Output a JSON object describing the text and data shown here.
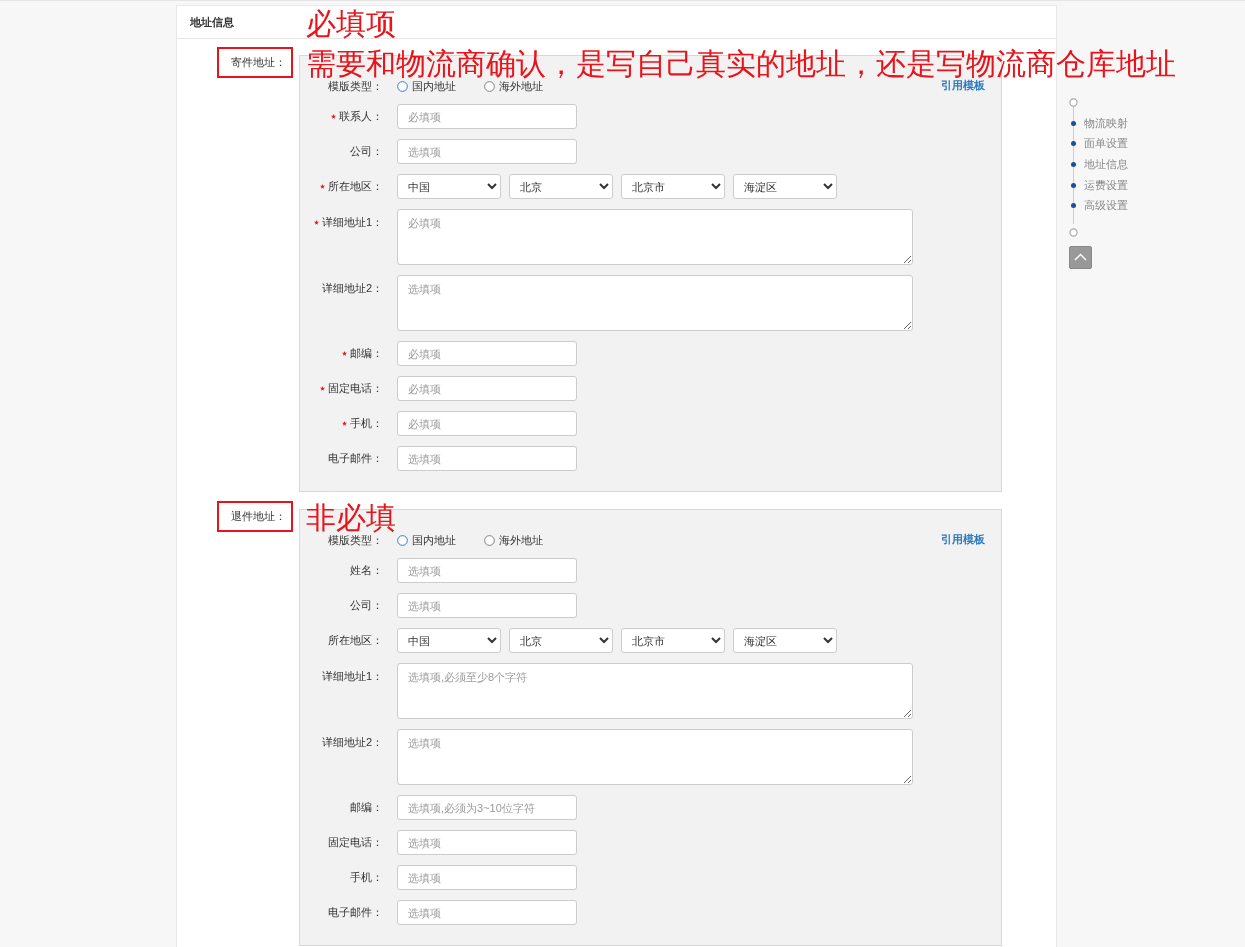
{
  "card": {
    "title": "地址信息"
  },
  "sections": [
    {
      "label": "寄件地址：",
      "highlighted": true,
      "annotations": [
        "必填项",
        "需要和物流商确认，是写自己真实的地址，还是写物流商仓库地址"
      ],
      "template_type": {
        "label": "模版类型：",
        "options": [
          {
            "label": "国内地址",
            "selected": true
          },
          {
            "label": "海外地址",
            "selected": false
          }
        ]
      },
      "template_link": "引用模板",
      "fields": [
        {
          "kind": "input",
          "label": "联系人：",
          "required": true,
          "placeholder": "必填项"
        },
        {
          "kind": "input",
          "label": "公司：",
          "required": false,
          "placeholder": "选填项"
        },
        {
          "kind": "selects",
          "label": "所在地区：",
          "required": true,
          "values": [
            "中国",
            "北京",
            "北京市",
            "海淀区"
          ]
        },
        {
          "kind": "textarea",
          "label": "详细地址1：",
          "required": true,
          "placeholder": "必填项"
        },
        {
          "kind": "textarea",
          "label": "详细地址2：",
          "required": false,
          "placeholder": "选填项"
        },
        {
          "kind": "input",
          "label": "邮编：",
          "required": true,
          "placeholder": "必填项"
        },
        {
          "kind": "input",
          "label": "固定电话：",
          "required": true,
          "placeholder": "必填项"
        },
        {
          "kind": "input",
          "label": "手机：",
          "required": true,
          "placeholder": "必填项"
        },
        {
          "kind": "input",
          "label": "电子邮件：",
          "required": false,
          "placeholder": "选填项"
        }
      ]
    },
    {
      "label": "退件地址：",
      "highlighted": true,
      "annotations": [
        "非必填"
      ],
      "template_type": {
        "label": "模版类型：",
        "options": [
          {
            "label": "国内地址",
            "selected": true
          },
          {
            "label": "海外地址",
            "selected": false
          }
        ]
      },
      "template_link": "引用模板",
      "fields": [
        {
          "kind": "input",
          "label": "姓名：",
          "required": false,
          "placeholder": "选填项"
        },
        {
          "kind": "input",
          "label": "公司：",
          "required": false,
          "placeholder": "选填项"
        },
        {
          "kind": "selects",
          "label": "所在地区：",
          "required": false,
          "values": [
            "中国",
            "北京",
            "北京市",
            "海淀区"
          ]
        },
        {
          "kind": "textarea",
          "label": "详细地址1：",
          "required": false,
          "placeholder": "选填项,必须至少8个字符"
        },
        {
          "kind": "textarea",
          "label": "详细地址2：",
          "required": false,
          "placeholder": "选填项"
        },
        {
          "kind": "input",
          "label": "邮编：",
          "required": false,
          "placeholder": "选填项,必须为3~10位字符"
        },
        {
          "kind": "input",
          "label": "固定电话：",
          "required": false,
          "placeholder": "选填项"
        },
        {
          "kind": "input",
          "label": "手机：",
          "required": false,
          "placeholder": "选填项"
        },
        {
          "kind": "input",
          "label": "电子邮件：",
          "required": false,
          "placeholder": "选填项"
        }
      ]
    }
  ],
  "side_nav": {
    "items": [
      "物流映射",
      "面单设置",
      "地址信息",
      "运费设置",
      "高级设置"
    ]
  }
}
